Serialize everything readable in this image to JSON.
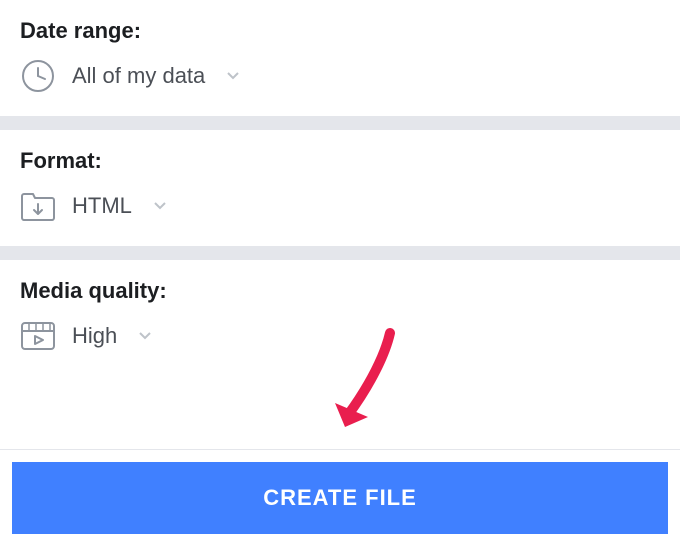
{
  "dateRange": {
    "label": "Date range:",
    "value": "All of my data"
  },
  "format": {
    "label": "Format:",
    "value": "HTML"
  },
  "mediaQuality": {
    "label": "Media quality:",
    "value": "High"
  },
  "createButton": {
    "label": "CREATE FILE"
  }
}
